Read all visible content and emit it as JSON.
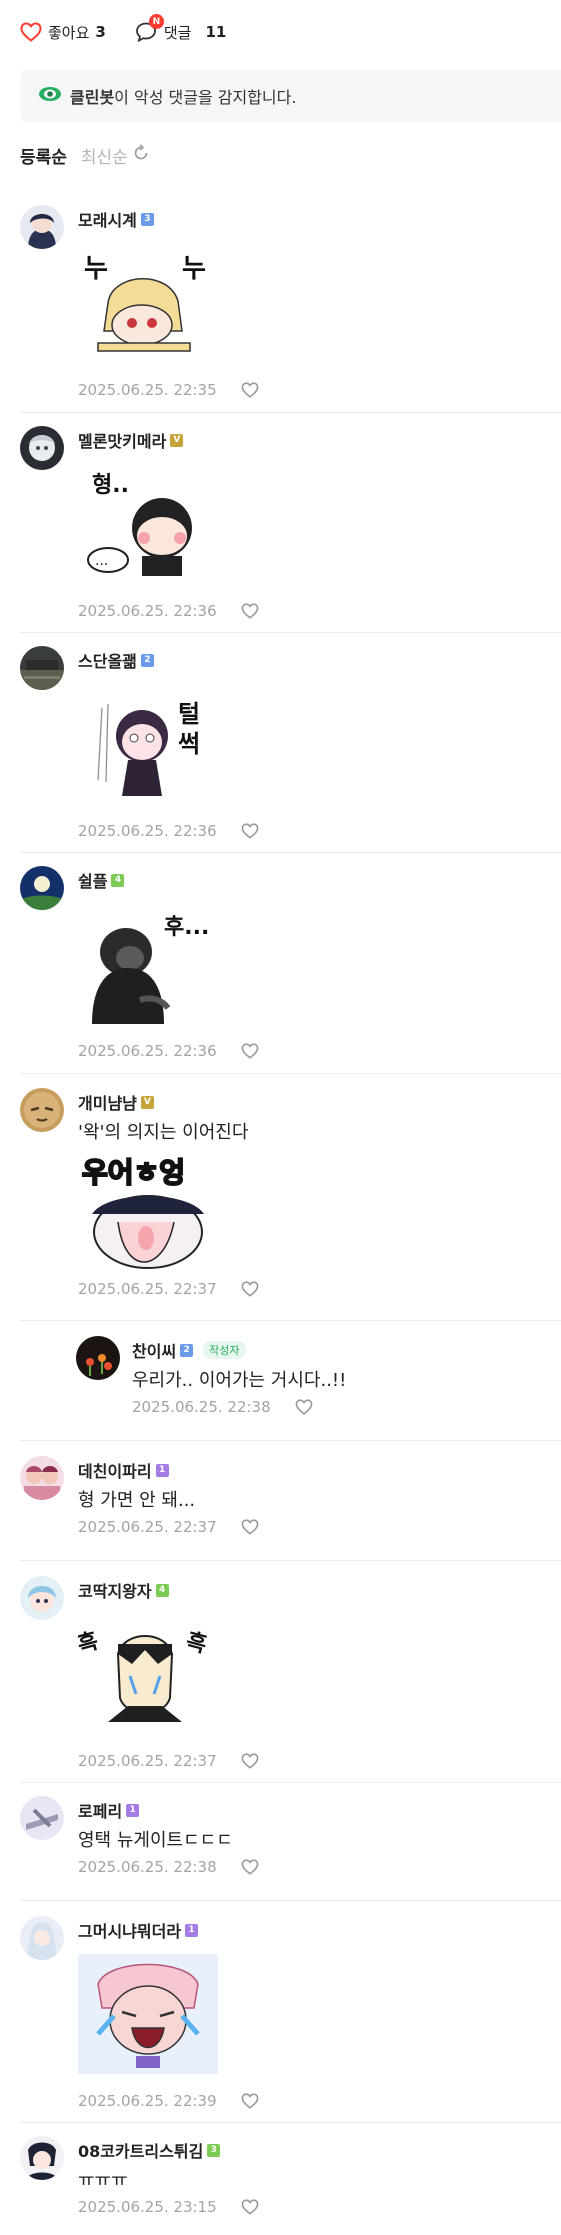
{
  "header": {
    "like_label": "좋아요",
    "like_count": "3",
    "comment_label": "댓글",
    "comment_count": "11",
    "new_badge": "N"
  },
  "cleanbot": {
    "name": "클린봇",
    "text": "이 악성 댓글을 감지합니다."
  },
  "sort": {
    "active": "등록순",
    "inactive": "최신순"
  },
  "colors": {
    "level_blue": "#6c9bea",
    "level_gold": "#c5a53b",
    "level_green": "#7ccb55",
    "level_purple": "#a57ce6",
    "cleanbot_green": "#27ae60"
  },
  "comments": [
    {
      "nickname": "모래시계",
      "level": "3",
      "text": "",
      "sticker": "sticker-nuk",
      "sticker_text": "누 누",
      "date": "2025.06.25. 22:35"
    },
    {
      "nickname": "멜론맛키메라",
      "level": "V",
      "text": "",
      "sticker": "sticker-hyung",
      "sticker_text": "형..",
      "date": "2025.06.25. 22:36"
    },
    {
      "nickname": "스단올괢",
      "level": "2",
      "text": "",
      "sticker": "sticker-teolsseok",
      "sticker_text": "털썩",
      "date": "2025.06.25. 22:36"
    },
    {
      "nickname": "쉴플",
      "level": "4",
      "text": "",
      "sticker": "sticker-hu",
      "sticker_text": "후...",
      "date": "2025.06.25. 22:36"
    },
    {
      "nickname": "개미냠냠",
      "level": "V",
      "text": "'왁'의 의지는 이어진다",
      "sticker": "sticker-ueoeung",
      "sticker_text": "우어ㅎ엉",
      "date": "2025.06.25. 22:37"
    },
    {
      "nickname": "찬이씨",
      "level": "2",
      "author_tag": "작성자",
      "text": "우리가.. 이어가는 거시다..!!",
      "sticker": "",
      "date": "2025.06.25. 22:38"
    },
    {
      "nickname": "데친이파리",
      "level": "1",
      "text": "형 가면 안 돼...",
      "sticker": "",
      "date": "2025.06.25. 22:37"
    },
    {
      "nickname": "코딱지왕자",
      "level": "4",
      "text": "",
      "sticker": "sticker-heuk",
      "sticker_text": "흑 흑",
      "date": "2025.06.25. 22:37"
    },
    {
      "nickname": "로페리",
      "level": "1",
      "text": "영택 뉴게이트ㄷㄷㄷ",
      "sticker": "",
      "date": "2025.06.25. 22:38"
    },
    {
      "nickname": "그머시냐뭐더라",
      "level": "1",
      "text": "",
      "sticker": "sticker-crying",
      "date": "2025.06.25. 22:39"
    },
    {
      "nickname": "08코카트리스튀김",
      "level": "3",
      "text": "ㅠㅠㅠ",
      "sticker": "",
      "date": "2025.06.25. 23:15"
    }
  ]
}
